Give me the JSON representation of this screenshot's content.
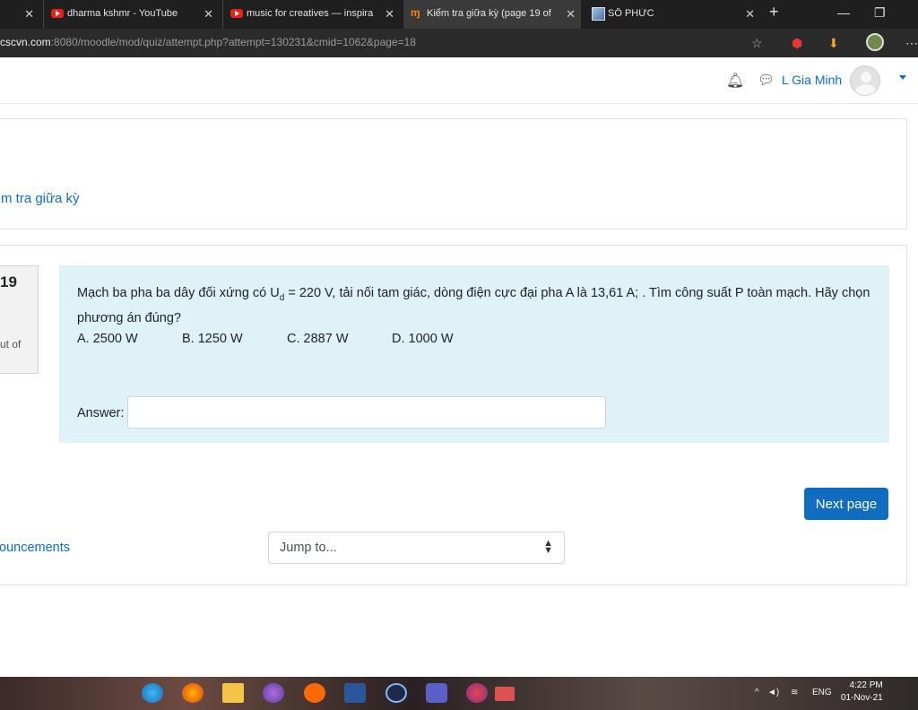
{
  "browser": {
    "tabs": [
      {
        "title": "",
        "icon": "blank"
      },
      {
        "title": "dharma kshmr - YouTube",
        "icon": "youtube-icon"
      },
      {
        "title": "music for creatives — inspira",
        "icon": "youtube-icon"
      },
      {
        "title": "Kiểm tra giữa kỳ (page 19 of",
        "icon": "moodle-icon",
        "active": true
      },
      {
        "title": "SỐ PHỨC",
        "icon": "image-icon"
      }
    ],
    "url_domain": "cscvn.com",
    "url_path": ":8080/moodle/mod/quiz/attempt.php?attempt=130231&cmid=1062&page=18"
  },
  "header": {
    "user_name": "L Gia Minh"
  },
  "breadcrumb": {
    "text": "m tra giữa kỳ"
  },
  "question": {
    "number": "19",
    "mark_text": "ut of",
    "text_prefix": "Mạch ba pha ba dây đối xứng có U",
    "text_sub": "d",
    "text_suffix": " = 220 V, tải nối tam giác, dòng điện cực đại pha A là 13,61 A; . Tìm công suất P toàn mạch. Hãy chọn phương án đúng?",
    "options": [
      "A. 2500 W",
      "B. 1250 W",
      "C. 2887 W",
      "D. 1000 W"
    ],
    "answer_label": "Answer:",
    "answer_value": ""
  },
  "nav": {
    "next_label": "Next page",
    "announcements_label": "ouncements",
    "jump_label": "Jump to..."
  },
  "taskbar": {
    "lang": "ENG",
    "time": "4:22 PM",
    "date": "01-Nov-21"
  },
  "colors": {
    "accent": "#0f6cbf",
    "question_bg": "#def2f8"
  }
}
